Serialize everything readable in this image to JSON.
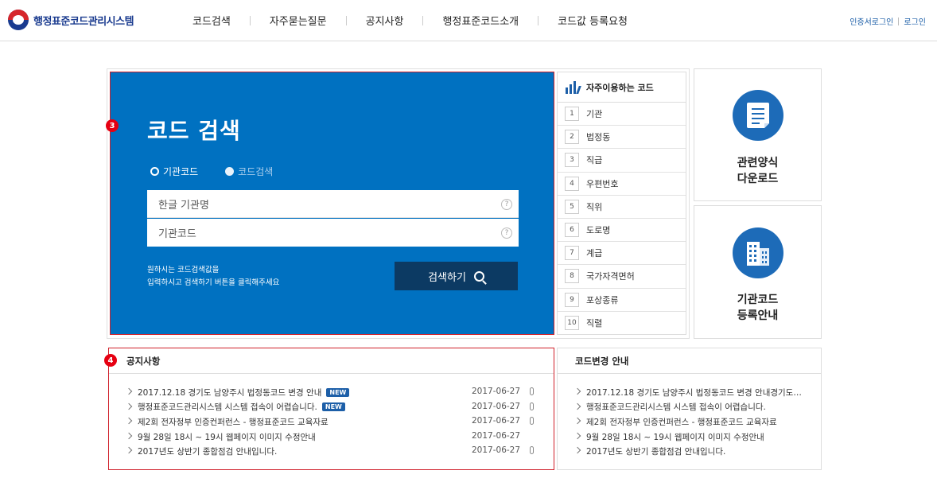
{
  "header": {
    "logo_title": "행정표준코드관리시스템",
    "nav": [
      "코드검색",
      "자주묻는질문",
      "공지사항",
      "행정표준코드소개",
      "코드값 등록요청"
    ],
    "util": [
      "인증서로그인",
      "로그인"
    ]
  },
  "markers": {
    "search": "3",
    "notice": "4"
  },
  "search": {
    "title": "코드 검색",
    "radio_on": "기관코드",
    "radio_off": "코드검색",
    "input1": "한글 기관명",
    "input2": "기관코드",
    "help": "?",
    "hint1": "원하시는 코드검색값을",
    "hint2": "입력하시고 검색하기 버튼을 클릭해주세요",
    "button": "검색하기"
  },
  "frequent": {
    "title": "자주이용하는 코드",
    "items": [
      {
        "n": "1",
        "label": "기관"
      },
      {
        "n": "2",
        "label": "법정동"
      },
      {
        "n": "3",
        "label": "직급"
      },
      {
        "n": "4",
        "label": "우편번호"
      },
      {
        "n": "5",
        "label": "직위"
      },
      {
        "n": "6",
        "label": "도로명"
      },
      {
        "n": "7",
        "label": "계급"
      },
      {
        "n": "8",
        "label": "국가자격면허"
      },
      {
        "n": "9",
        "label": "포상종류"
      },
      {
        "n": "10",
        "label": "직렬"
      }
    ]
  },
  "cards": {
    "forms_line1": "관련양식",
    "forms_line2": "다운로드",
    "register_line1": "기관코드",
    "register_line2": "등록안내"
  },
  "notice": {
    "title": "공지사항",
    "new_label": "NEW",
    "items": [
      {
        "text": "2017.12.18 경기도 남양주시 법정동코드 변경 안내",
        "date": "2017-06-27"
      },
      {
        "text": "행정표준코드관리시스템 시스템 접속이 어렵습니다.",
        "date": "2017-06-27"
      },
      {
        "text": "제2회 전자정부 인증컨퍼런스 - 행정표준코드 교육자료",
        "date": "2017-06-27"
      },
      {
        "text": "9월 28일 18시 ~ 19시 웹페이지 이미지 수정안내",
        "date": "2017-06-27"
      },
      {
        "text": "2017년도 상반기 종합점검 안내입니다.",
        "date": "2017-06-27"
      }
    ]
  },
  "code_change": {
    "title": "코드변경 안내",
    "items": [
      "2017.12.18 경기도 남양주시 법정동코드 변경 안내경기도…",
      "행정표준코드관리시스템 시스템 접속이 어렵습니다.",
      "제2회 전자정부 인증컨퍼런스 - 행정표준코드 교육자료",
      "9월 28일 18시 ~ 19시 웹페이지 이미지 수정안내",
      "2017년도 상반기 종합점검 안내입니다."
    ]
  }
}
